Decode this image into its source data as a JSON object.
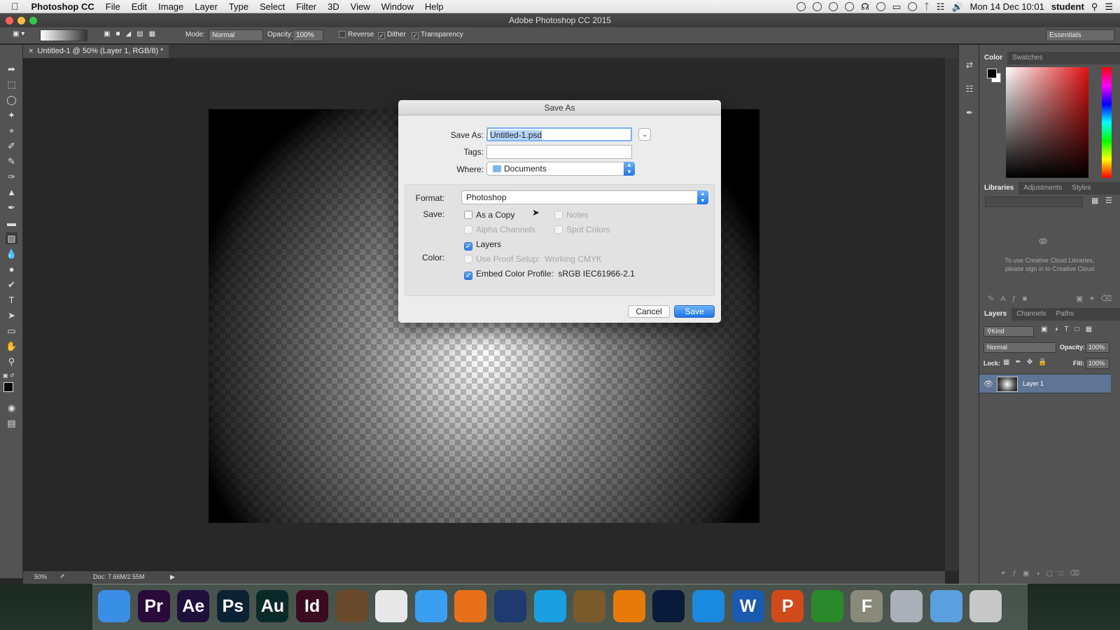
{
  "menubar": {
    "app_name": "Photoshop CC",
    "items": [
      "File",
      "Edit",
      "Image",
      "Layer",
      "Type",
      "Select",
      "Filter",
      "3D",
      "View",
      "Window",
      "Help"
    ],
    "clock": "Mon 14 Dec  10:01",
    "user": "student"
  },
  "window": {
    "title": "Adobe Photoshop CC 2015"
  },
  "options_bar": {
    "mode_label": "Mode:",
    "mode_value": "Normal",
    "opacity_label": "Opacity:",
    "opacity_value": "100%",
    "reverse_label": "Reverse",
    "dither_label": "Dither",
    "transparency_label": "Transparency",
    "workspace_value": "Essentials"
  },
  "document": {
    "tab_label": "Untitled-1 @ 50% (Layer 1, RGB/8) *",
    "zoom": "50%",
    "doc_info": "Doc: 7.66M/2.55M"
  },
  "dialog": {
    "title": "Save As",
    "save_as_label": "Save As:",
    "filename": "Untitled-1.psd",
    "tags_label": "Tags:",
    "tags_value": "",
    "where_label": "Where:",
    "where_value": "Documents",
    "format_label": "Format:",
    "format_value": "Photoshop",
    "save_label": "Save:",
    "as_copy": "As a Copy",
    "notes": "Notes",
    "alpha_channels": "Alpha Channels",
    "spot_colors": "Spot Colors",
    "layers": "Layers",
    "color_label": "Color:",
    "use_proof": "Use Proof Setup:",
    "proof_value": "Working CMYK",
    "embed_profile": "Embed Color Profile:",
    "profile_value": "sRGB IEC61966-2.1",
    "cancel": "Cancel",
    "save": "Save"
  },
  "right_panel": {
    "color_tabs": [
      "Color",
      "Swatches"
    ],
    "lib_tabs": [
      "Libraries",
      "Adjustments",
      "Styles"
    ],
    "lib_message_1": "To use Creative Cloud Libraries,",
    "lib_message_2": "please sign in to Creative Cloud",
    "layer_tabs": [
      "Layers",
      "Channels",
      "Paths"
    ],
    "kind_label": "Kind",
    "blend_mode": "Normal",
    "opacity_label": "Opacity:",
    "opacity_value": "100%",
    "lock_label": "Lock:",
    "fill_label": "Fill:",
    "fill_value": "100%",
    "layer_name": "Layer 1"
  },
  "dock": {
    "apps": [
      {
        "label": "",
        "icon": "finder-icon",
        "color": "#3a8ee6"
      },
      {
        "label": "Pr",
        "icon": "premiere-icon",
        "color": "#2a0a3a"
      },
      {
        "label": "Ae",
        "icon": "after-effects-icon",
        "color": "#1f0f3d"
      },
      {
        "label": "Ps",
        "icon": "photoshop-icon",
        "color": "#0a2233"
      },
      {
        "label": "Au",
        "icon": "audition-icon",
        "color": "#0a2a2a"
      },
      {
        "label": "Id",
        "icon": "indesign-icon",
        "color": "#3a0a1f"
      },
      {
        "label": "",
        "icon": "garageband-icon",
        "color": "#6a4a2a"
      },
      {
        "label": "",
        "icon": "chrome-icon",
        "color": "#e8e8e8"
      },
      {
        "label": "",
        "icon": "safari-icon",
        "color": "#3a9ff0"
      },
      {
        "label": "",
        "icon": "firefox-icon",
        "color": "#e8701a"
      },
      {
        "label": "",
        "icon": "migration-assistant-icon",
        "color": "#1e3a6e"
      },
      {
        "label": "",
        "icon": "skype-icon",
        "color": "#1aa0e0"
      },
      {
        "label": "",
        "icon": "cocktail-icon",
        "color": "#7a5a2a"
      },
      {
        "label": "",
        "icon": "vlc-icon",
        "color": "#e87a0a"
      },
      {
        "label": "",
        "icon": "quicktime-icon",
        "color": "#0a1a3a"
      },
      {
        "label": "",
        "icon": "quicktime-q-icon",
        "color": "#1a8ae0"
      },
      {
        "label": "W",
        "icon": "word-icon",
        "color": "#1a5ab0"
      },
      {
        "label": "P",
        "icon": "powerpoint-icon",
        "color": "#d04a1a"
      },
      {
        "label": "",
        "icon": "camtasia-icon",
        "color": "#2a8a2a"
      },
      {
        "label": "F",
        "icon": "fontbook-icon",
        "color": "#8a8a7a"
      },
      {
        "label": "",
        "icon": "preview-icon",
        "color": "#aab0b8"
      },
      {
        "label": "",
        "icon": "downloads-icon",
        "color": "#5aa0e0"
      },
      {
        "label": "",
        "icon": "trash-icon",
        "color": "#c8c8c8"
      }
    ]
  },
  "colors": {
    "accent": "#2a7be4",
    "panel": "#535353",
    "workspace": "#282828"
  }
}
